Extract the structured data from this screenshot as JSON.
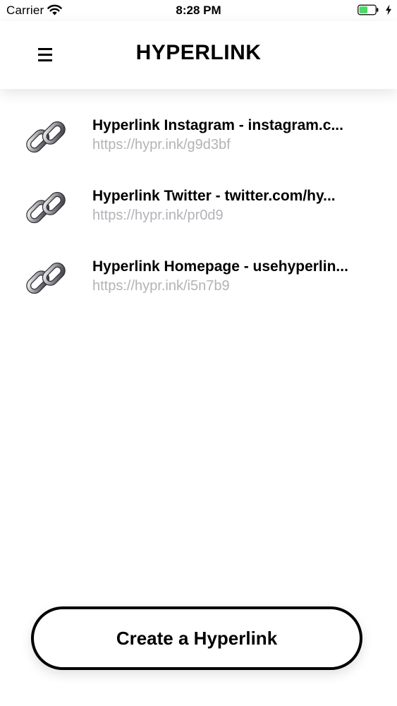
{
  "status_bar": {
    "carrier": "Carrier",
    "time": "8:28 PM",
    "battery_color": "#4cd964"
  },
  "nav": {
    "title": "HYPERLINK",
    "menu_icon": "hamburger-menu-icon"
  },
  "links": [
    {
      "title": "Hyperlink Instagram - instagram.c...",
      "url": "https://hypr.ink/g9d3bf",
      "icon": "chain-link-icon"
    },
    {
      "title": "Hyperlink Twitter - twitter.com/hy...",
      "url": "https://hypr.ink/pr0d9",
      "icon": "chain-link-icon"
    },
    {
      "title": "Hyperlink Homepage - usehyperlin...",
      "url": "https://hypr.ink/i5n7b9",
      "icon": "chain-link-icon"
    }
  ],
  "create_button": {
    "label": "Create a Hyperlink"
  },
  "colors": {
    "url_text": "#b3b3b8",
    "primary": "#000000",
    "background": "#ffffff"
  }
}
